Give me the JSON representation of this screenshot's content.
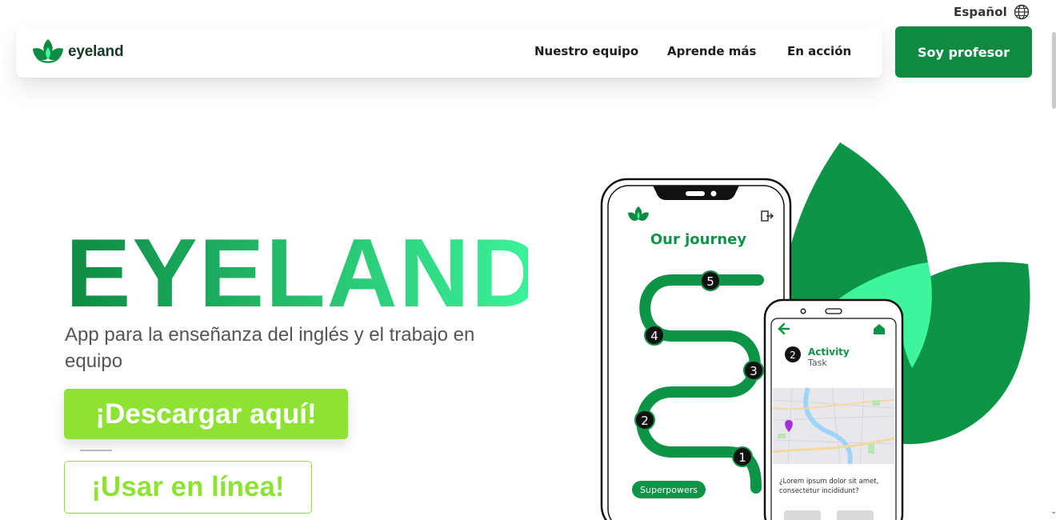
{
  "language": {
    "label": "Español",
    "icon": "globe-icon"
  },
  "brand": {
    "name": "eyeland",
    "color": "#0e8a43"
  },
  "nav": {
    "links": [
      "Nuestro equipo",
      "Aprende más",
      "En acción"
    ],
    "cta": "Soy profesor"
  },
  "hero": {
    "title": "EYELAND",
    "subtitle": "App para la enseñanza del inglés y el trabajo en equipo",
    "download_button": "¡Descargar aquí!",
    "online_button": "¡Usar en línea!",
    "gradient": [
      "#0e8a43",
      "#3df59a"
    ]
  },
  "phone_main": {
    "title": "Our journey",
    "steps": [
      "5",
      "4",
      "3",
      "2",
      "1"
    ],
    "badge": "Superpowers"
  },
  "phone_small": {
    "step": "2",
    "activity": "Activity",
    "task": "Task",
    "question": "¿Lorem ipsum dolor sit amet, consectetur incididunt?"
  },
  "colors": {
    "primary": "#0e8a43",
    "accent": "#8ee234",
    "leaf_light": "#3df59a",
    "text_dark": "#1c1c1c"
  }
}
